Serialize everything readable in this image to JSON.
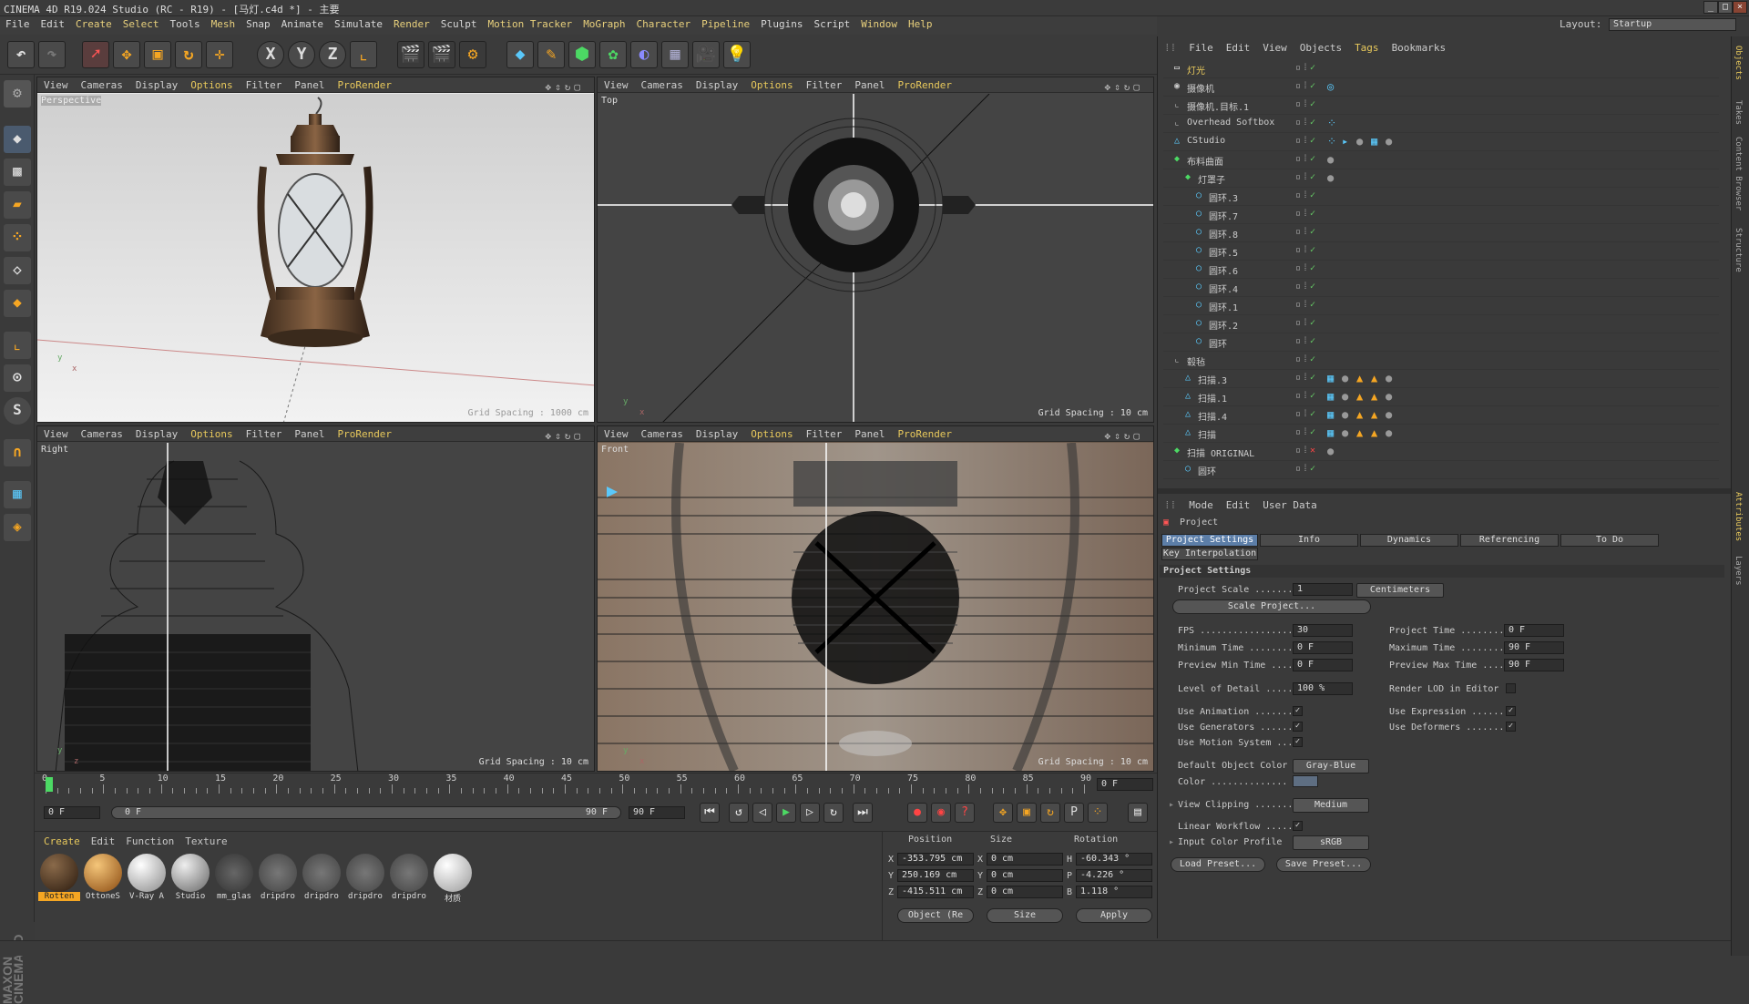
{
  "window": {
    "title": "CINEMA 4D R19.024 Studio (RC - R19) - [马灯.c4d *] - 主要",
    "layout_label": "Layout:",
    "layout_value": "Startup"
  },
  "menubar": [
    "File",
    "Edit",
    "Create",
    "Select",
    "Tools",
    "Mesh",
    "Snap",
    "Animate",
    "Simulate",
    "Render",
    "Sculpt",
    "Motion Tracker",
    "MoGraph",
    "Character",
    "Pipeline",
    "Plugins",
    "Script",
    "Window",
    "Help"
  ],
  "viewport_menu": [
    "View",
    "Cameras",
    "Display",
    "Options",
    "Filter",
    "Panel",
    "ProRender"
  ],
  "viewports": [
    {
      "name": "Perspective",
      "label": "Perspective",
      "grid": "Grid Spacing : 1000 cm"
    },
    {
      "name": "Top",
      "label": "Top",
      "grid": "Grid Spacing : 10 cm"
    },
    {
      "name": "Right",
      "label": "Right",
      "grid": "Grid Spacing : 10 cm"
    },
    {
      "name": "Front",
      "label": "Front",
      "grid": "Grid Spacing : 10 cm"
    }
  ],
  "timeline": {
    "ticks": [
      "0",
      "5",
      "10",
      "15",
      "20",
      "25",
      "30",
      "35",
      "40",
      "45",
      "50",
      "55",
      "60",
      "65",
      "70",
      "75",
      "80",
      "85",
      "90"
    ],
    "current": "0 F",
    "start": "0 F",
    "slider_left": "0 F",
    "slider_right": "90 F",
    "end": "90 F"
  },
  "materials": {
    "menu": [
      "Create",
      "Edit",
      "Function",
      "Texture"
    ],
    "items": [
      "Rotten",
      "OttoneS",
      "V-Ray A",
      "Studio",
      "mm_glas",
      "dripdro",
      "dripdro",
      "dripdro",
      "dripdro",
      "材质"
    ]
  },
  "coords": {
    "headers": [
      "Position",
      "Size",
      "Rotation"
    ],
    "rows": [
      {
        "axis": "X",
        "pos": "-353.795 cm",
        "saxis": "X",
        "size": "0 cm",
        "raxis": "H",
        "rot": "-60.343 °"
      },
      {
        "axis": "Y",
        "pos": "250.169 cm",
        "saxis": "Y",
        "size": "0 cm",
        "raxis": "P",
        "rot": "-4.226 °"
      },
      {
        "axis": "Z",
        "pos": "-415.511 cm",
        "saxis": "Z",
        "size": "0 cm",
        "raxis": "B",
        "rot": "1.118 °"
      }
    ],
    "mode": "Object (Re",
    "size_mode": "Size",
    "apply": "Apply"
  },
  "object_manager": {
    "menu": [
      "File",
      "Edit",
      "View",
      "Objects",
      "Tags",
      "Bookmarks"
    ],
    "objects": [
      "灯光",
      "摄像机",
      "摄像机.目标.1",
      "Overhead Softbox",
      "CStudio",
      "布料曲面",
      "灯罩子",
      "圆环.3",
      "圆环.7",
      "圆环.8",
      "圆环.5",
      "圆环.6",
      "圆环.4",
      "圆环.1",
      "圆环.2",
      "圆环",
      "毂毡",
      "扫描.3",
      "扫描.1",
      "扫描.4",
      "扫描",
      "扫描 ORIGINAL",
      "圆环"
    ]
  },
  "attributes": {
    "menu": [
      "Mode",
      "Edit",
      "User Data"
    ],
    "object": "Project",
    "tabs": [
      "Project Settings",
      "Info",
      "Dynamics",
      "Referencing",
      "To Do"
    ],
    "tab2": "Key Interpolation",
    "section": "Project Settings",
    "project_scale_label": "Project Scale ........",
    "project_scale": "1",
    "project_scale_unit": "Centimeters",
    "scale_btn": "Scale Project...",
    "fps_label": "FPS ..................",
    "fps": "30",
    "ptime_label": "Project Time .........",
    "ptime": "0 F",
    "mintime_label": "Minimum Time .........",
    "mintime": "0 F",
    "maxtime_label": "Maximum Time .........",
    "maxtime": "90 F",
    "pmin_label": "Preview Min Time .....",
    "pmin": "0 F",
    "pmax_label": "Preview Max Time .....",
    "pmax": "90 F",
    "lod_label": "Level of Detail ......",
    "lod": "100 %",
    "rlod_label": "Render LOD in Editor",
    "anim_label": "Use Animation .......",
    "expr_label": "Use Expression .......",
    "gen_label": "Use Generators ......",
    "def_label": "Use Deformers .......",
    "motion_label": "Use Motion System ...",
    "doc_label": "Default Object Color",
    "doc": "Gray-Blue",
    "color_label": "Color ..............",
    "clip_label": "View Clipping .......",
    "clip": "Medium",
    "lin_label": "Linear Workflow .....",
    "icp_label": "Input Color Profile",
    "icp": "sRGB",
    "load": "Load Preset...",
    "save": "Save Preset..."
  },
  "side_tabs": [
    "Objects",
    "Takes",
    "Content Browser",
    "Structure",
    "Attributes",
    "Layers"
  ]
}
